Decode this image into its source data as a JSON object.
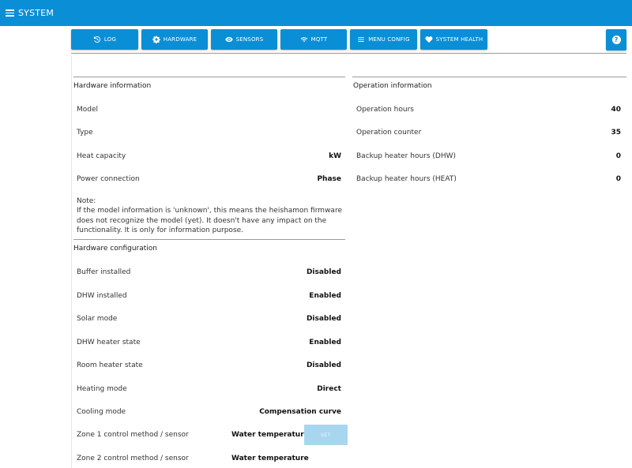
{
  "header": {
    "title": "SYSTEM"
  },
  "tabs": [
    {
      "label": "LOG",
      "icon": "history-icon"
    },
    {
      "label": "HARDWARE",
      "icon": "gear-icon"
    },
    {
      "label": "SENSORS",
      "icon": "eye-icon"
    },
    {
      "label": "MQTT",
      "icon": "wifi-icon"
    },
    {
      "label": "MENU CONFIG",
      "icon": "menu-icon"
    },
    {
      "label": "SYSTEM HEALTH",
      "icon": "heart-icon"
    }
  ],
  "help": {
    "icon": "help-icon"
  },
  "hardware_info": {
    "title": "Hardware information",
    "rows": [
      {
        "label": "Model",
        "value": ""
      },
      {
        "label": "Type",
        "value": ""
      },
      {
        "label": "Heat capacity",
        "value": "kW"
      },
      {
        "label": "Power connection",
        "value": "Phase"
      }
    ],
    "note": "Note:\nIf the model information is 'unknown', this means the heishamon firmware does not recognize the model (yet). It doesn't have any impact on the functionality. It is only for information purpose."
  },
  "operation_info": {
    "title": "Operation information",
    "rows": [
      {
        "label": "Operation hours",
        "value": "40"
      },
      {
        "label": "Operation counter",
        "value": "35"
      },
      {
        "label": "Backup heater hours (DHW)",
        "value": "0"
      },
      {
        "label": "Backup heater hours (HEAT)",
        "value": "0"
      }
    ]
  },
  "hardware_config": {
    "title": "Hardware configuration",
    "rows": [
      {
        "label": "Buffer installed",
        "value": "Disabled"
      },
      {
        "label": "DHW installed",
        "value": "Enabled"
      },
      {
        "label": "Solar mode",
        "value": "Disabled"
      },
      {
        "label": "DHW heater state",
        "value": "Enabled"
      },
      {
        "label": "Room heater state",
        "value": "Disabled"
      },
      {
        "label": "Heating mode",
        "value": "Direct"
      },
      {
        "label": "Cooling mode",
        "value": "Compensation curve"
      }
    ],
    "zone1": {
      "label": "Zone 1 control method / sensor",
      "value": "Water temperature",
      "button": "SET"
    },
    "zone2": {
      "label": "Zone 2 control method / sensor",
      "value": "Water temperature"
    }
  }
}
